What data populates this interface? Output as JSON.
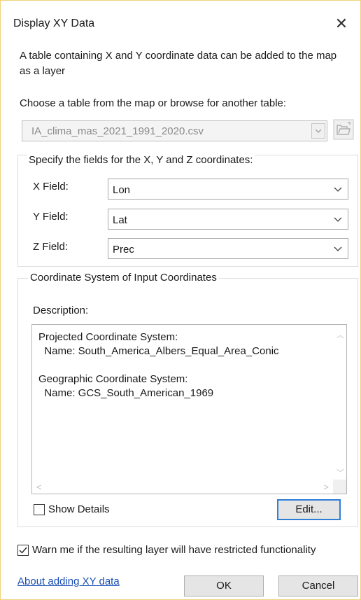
{
  "window": {
    "title": "Display XY Data"
  },
  "intro_text": "A table containing X and Y coordinate data can be added to the map as a layer",
  "choose_label": "Choose a table from the map or browse for another table:",
  "table_select": {
    "value": "IA_clima_mas_2021_1991_2020.csv",
    "enabled": false
  },
  "fields_group": {
    "label": "Specify the fields for the X, Y and Z coordinates:",
    "x": {
      "label": "X Field:",
      "value": "Lon"
    },
    "y": {
      "label": "Y Field:",
      "value": "Lat"
    },
    "z": {
      "label": "Z Field:",
      "value": "Prec"
    }
  },
  "coord_group": {
    "label": "Coordinate System of Input Coordinates",
    "description_label": "Description:",
    "description_text": "Projected Coordinate System:\n  Name: South_America_Albers_Equal_Area_Conic\n\nGeographic Coordinate System:\n  Name: GCS_South_American_1969",
    "show_details_label": "Show Details",
    "show_details_checked": false,
    "edit_label": "Edit..."
  },
  "warn_checkbox": {
    "label": "Warn me if the resulting layer will have restricted functionality",
    "checked": true
  },
  "about_link": "About adding XY data",
  "ok_label": "OK",
  "cancel_label": "Cancel",
  "colors": {
    "accent": "#2f7fd6",
    "link": "#1a4fb3",
    "window_border": "#f0d27a"
  },
  "icons": [
    "close-icon",
    "browse-folder-icon",
    "chevron-down-icon",
    "checkmark-icon"
  ]
}
